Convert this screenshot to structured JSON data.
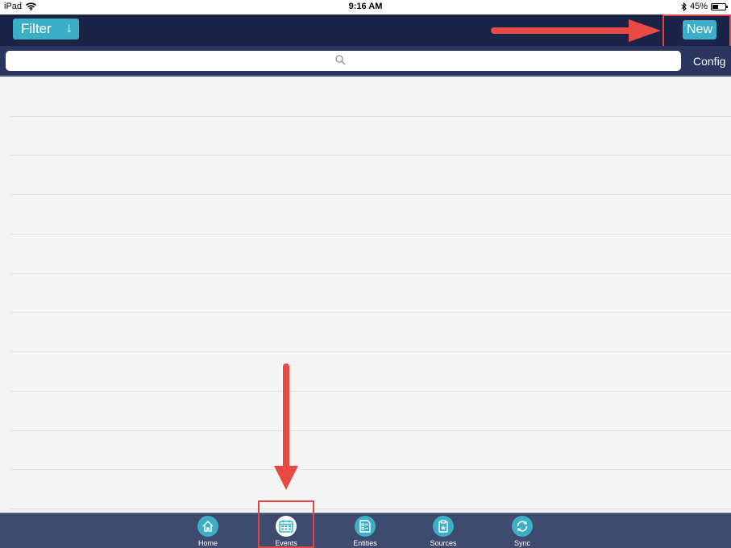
{
  "status_bar": {
    "device": "iPad",
    "time": "9:16 AM",
    "battery_percent": "45%",
    "battery_level": 0.45,
    "icons": [
      "wifi-icon",
      "bluetooth-icon",
      "battery-icon"
    ]
  },
  "navbar": {
    "filter_label": "Filter",
    "filter_arrow": "↓",
    "new_label": "New"
  },
  "search": {
    "placeholder": "",
    "value": "",
    "icon": "search-icon",
    "config_label": "Config"
  },
  "list": {
    "row_count": 11
  },
  "tabbar": {
    "tabs": [
      {
        "label": "Home",
        "icon": "home-icon",
        "active": false
      },
      {
        "label": "Events",
        "icon": "calendar-icon",
        "active": true
      },
      {
        "label": "Entities",
        "icon": "form-icon",
        "active": false
      },
      {
        "label": "Sources",
        "icon": "clipboard-icon",
        "active": false
      },
      {
        "label": "Sync",
        "icon": "sync-icon",
        "active": false
      }
    ]
  },
  "annotations": {
    "color": "#e04545",
    "targets": [
      "new-button",
      "tab-events"
    ]
  }
}
